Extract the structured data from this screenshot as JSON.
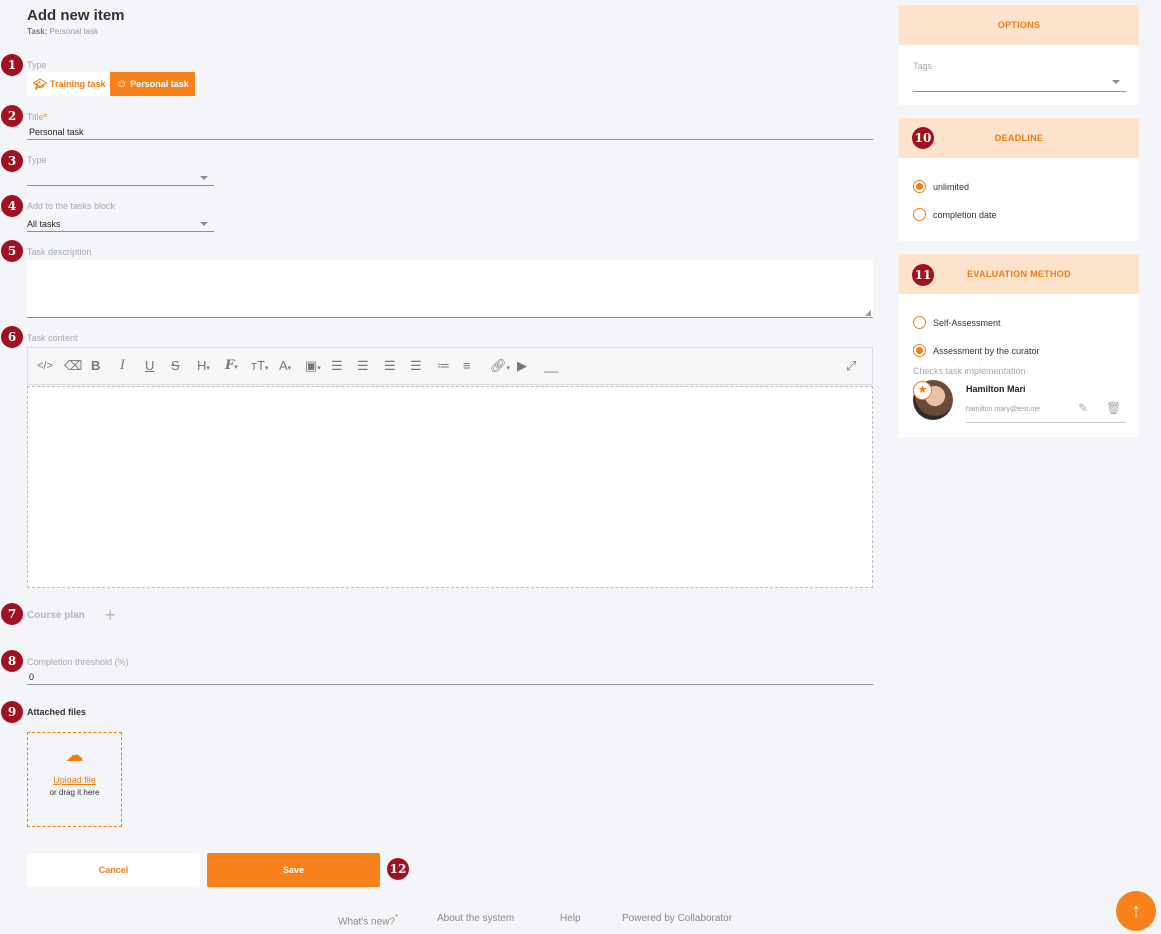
{
  "header": {
    "title": "Add new item",
    "subtitle_label": "Task:",
    "subtitle_value": "Personal task"
  },
  "badges": [
    "1",
    "2",
    "3",
    "4",
    "5",
    "6",
    "7",
    "8",
    "9",
    "10",
    "11",
    "12"
  ],
  "type_selector": {
    "label": "Type",
    "options": [
      "Training task",
      "Personal task"
    ],
    "selected": "Personal task"
  },
  "title_field": {
    "label": "Title",
    "required_mark": "*",
    "value": "Personal task"
  },
  "type_dropdown": {
    "label": "Type",
    "value": ""
  },
  "tasks_block": {
    "label": "Add to the tasks block",
    "value": "All tasks"
  },
  "description": {
    "label": "Task description",
    "value": ""
  },
  "content": {
    "label": "Task content"
  },
  "course_plan": {
    "label": "Course plan",
    "add_icon": "+"
  },
  "threshold": {
    "label": "Completion threshold (%)",
    "value": "0"
  },
  "attached": {
    "label": "Attached files",
    "upload_link": "Upload file",
    "drag_text": "or drag it here"
  },
  "buttons": {
    "cancel": "Cancel",
    "save": "Save"
  },
  "options_panel": {
    "title": "OPTIONS",
    "tags_label": "Tags",
    "tags_value": ""
  },
  "deadline_panel": {
    "title": "DEADLINE",
    "options": [
      "unlimited",
      "completion date"
    ],
    "selected": "unlimited"
  },
  "evaluation_panel": {
    "title": "EVALUATION METHOD",
    "options": [
      "Self-Assessment",
      "Assessment by the curator"
    ],
    "selected": "Assessment by the curator",
    "checker_label": "Checks task implementation",
    "checker_name": "Hamilton Mari",
    "checker_email": "hamilton.mary@test.me"
  },
  "footer": {
    "whats_new": "What's new?",
    "whats_new_mark": "*",
    "about": "About the system",
    "help": "Help",
    "powered": "Powered by Collaborator"
  },
  "colors": {
    "accent": "#f07c12",
    "badge": "#a11220",
    "panel_head": "#fde3cb",
    "background": "#f4f5f9"
  }
}
